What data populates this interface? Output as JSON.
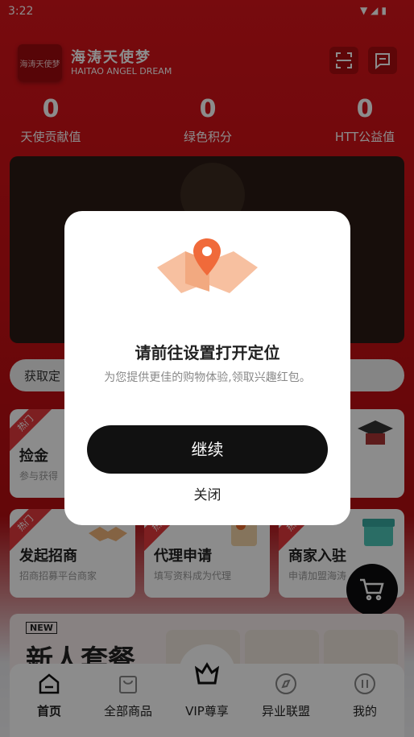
{
  "status": {
    "time": "3:22",
    "icons": "▼◢▮"
  },
  "header": {
    "logo_text": "海涛天使梦",
    "brand_cn": "海涛天使梦",
    "brand_en": "HAITAO ANGEL DREAM"
  },
  "stats": [
    {
      "value": "0",
      "label": "天使贡献值"
    },
    {
      "value": "0",
      "label": "绿色积分"
    },
    {
      "value": "0",
      "label": "HTT公益值"
    }
  ],
  "search": {
    "placeholder": "获取定"
  },
  "cards_row1": [
    {
      "hot": "热门",
      "title": "捡金",
      "sub": "参与获得"
    },
    {
      "hot": "热门",
      "title": "",
      "sub": ""
    },
    {
      "hot": "",
      "title": "",
      "sub": ""
    }
  ],
  "cards_row2": [
    {
      "hot": "热门",
      "title": "发起招商",
      "sub": "招商招募平台商家"
    },
    {
      "hot": "热门",
      "title": "代理申请",
      "sub": "填写资料成为代理"
    },
    {
      "hot": "热门",
      "title": "商家入驻",
      "sub": "申请加盟海涛"
    }
  ],
  "promo": {
    "new": "NEW",
    "title": "新人套餐"
  },
  "nav": [
    {
      "label": "首页",
      "icon": "home-icon"
    },
    {
      "label": "全部商品",
      "icon": "bag-icon"
    },
    {
      "label": "VIP尊享",
      "icon": "crown-icon"
    },
    {
      "label": "异业联盟",
      "icon": "compass-icon"
    },
    {
      "label": "我的",
      "icon": "profile-icon"
    }
  ],
  "modal": {
    "title": "请前往设置打开定位",
    "desc": "为您提供更佳的购物体验,领取兴趣红包。",
    "confirm": "继续",
    "close": "关闭"
  },
  "colors": {
    "brand_red": "#c80d12",
    "dark": "#111111"
  }
}
